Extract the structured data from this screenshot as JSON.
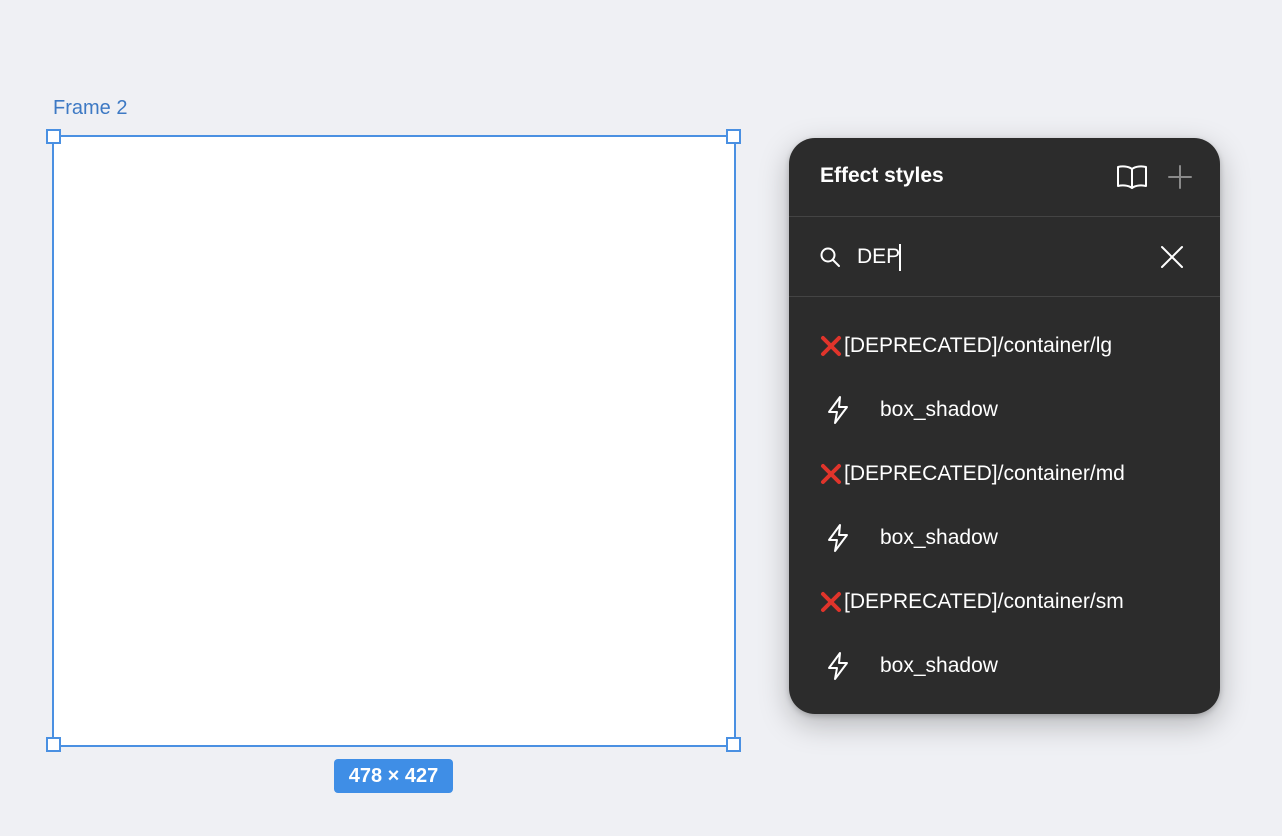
{
  "canvas": {
    "frame_name": "Frame 2",
    "size_label": "478 × 427"
  },
  "panel": {
    "title": "Effect styles",
    "header_icons": [
      "library-icon",
      "plus-icon"
    ],
    "search": {
      "value": "DEP",
      "icon": "search-icon",
      "clear_icon": "close-icon"
    },
    "groups": [
      {
        "label": "[DEPRECATED]/container/lg",
        "marker_icon": "red-x-icon",
        "styles": [
          {
            "label": "box_shadow",
            "icon": "lightning-icon"
          }
        ]
      },
      {
        "label": "[DEPRECATED]/container/md",
        "marker_icon": "red-x-icon",
        "styles": [
          {
            "label": "box_shadow",
            "icon": "lightning-icon"
          }
        ]
      },
      {
        "label": "[DEPRECATED]/container/sm",
        "marker_icon": "red-x-icon",
        "styles": [
          {
            "label": "box_shadow",
            "icon": "lightning-icon"
          }
        ]
      }
    ]
  },
  "colors": {
    "canvas_bg": "#eff0f4",
    "selection_blue": "#4a90e2",
    "panel_bg": "#2c2c2c",
    "deprecated_red": "#e0342b"
  }
}
